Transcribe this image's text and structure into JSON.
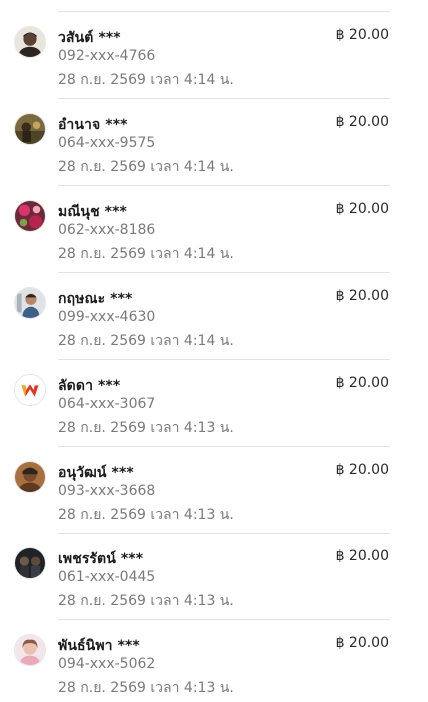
{
  "transactions": [
    {
      "name": "วสันต์ ***",
      "phone": "092-xxx-4766",
      "datetime": "28 ก.ย. 2569 เวลา 4:14 น.",
      "amount": "฿ 20.00",
      "avatar": "avatar-photo-man-dark"
    },
    {
      "name": "อำนาจ ***",
      "phone": "064-xxx-9575",
      "datetime": "28 ก.ย. 2569 เวลา 4:14 น.",
      "amount": "฿ 20.00",
      "avatar": "avatar-photo-outdoor"
    },
    {
      "name": "มณีนุช ***",
      "phone": "062-xxx-8186",
      "datetime": "28 ก.ย. 2569 เวลา 4:14 น.",
      "amount": "฿ 20.00",
      "avatar": "avatar-photo-flowers"
    },
    {
      "name": "กฤษณะ ***",
      "phone": "099-xxx-4630",
      "datetime": "28 ก.ย. 2569 เวลา 4:14 น.",
      "amount": "฿ 20.00",
      "avatar": "avatar-photo-person-light"
    },
    {
      "name": "ลัดดา ***",
      "phone": "064-xxx-3067",
      "datetime": "28 ก.ย. 2569 เวลา 4:13 น.",
      "amount": "฿ 20.00",
      "avatar": "avatar-logo-w"
    },
    {
      "name": "อนุวัฒน์ ***",
      "phone": "093-xxx-3668",
      "datetime": "28 ก.ย. 2569 เวลา 4:13 น.",
      "amount": "฿ 20.00",
      "avatar": "avatar-photo-man-brown"
    },
    {
      "name": "เพชรรัตน์ ***",
      "phone": "061-xxx-0445",
      "datetime": "28 ก.ย. 2569 เวลา 4:13 น.",
      "amount": "฿ 20.00",
      "avatar": "avatar-photo-group-dark"
    },
    {
      "name": "พันธ์นิพา ***",
      "phone": "094-xxx-5062",
      "datetime": "28 ก.ย. 2569 เวลา 4:13 น.",
      "amount": "฿ 20.00",
      "avatar": "avatar-photo-girl-pink"
    }
  ],
  "colors": {
    "name": "#1c1c1c",
    "secondary_text": "#7a7a7a",
    "divider": "#e3e3e3",
    "logo_orange": "#f5a623",
    "logo_red": "#e8321e"
  }
}
